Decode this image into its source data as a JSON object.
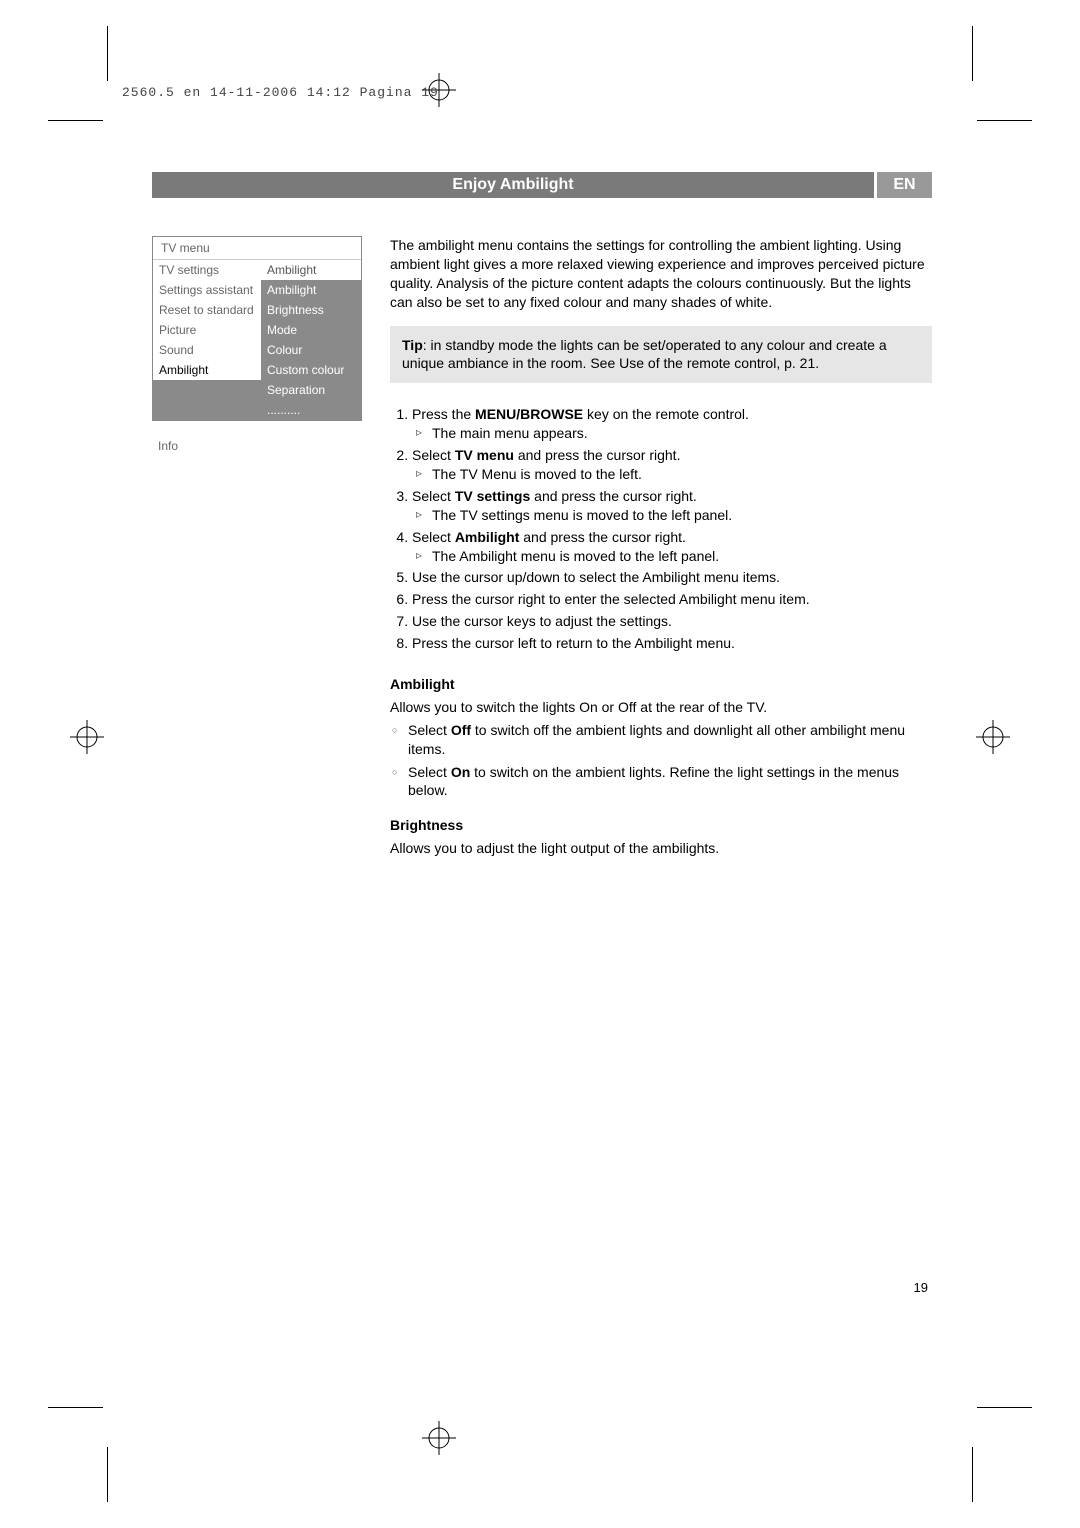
{
  "meta_header": "2560.5 en  14-11-2006  14:12  Pagina 19",
  "title": "Enjoy Ambilight",
  "lang_tag": "EN",
  "menu": {
    "header": "TV menu",
    "left": [
      "TV settings",
      "Settings assistant",
      "Reset to standard",
      "Picture",
      "Sound",
      "Ambilight"
    ],
    "right_header": "Ambilight",
    "right": [
      "Ambilight",
      "Brightness",
      "Mode",
      "Colour",
      "Custom colour",
      "Separation",
      ".........."
    ],
    "info": "Info"
  },
  "intro": "The ambilight menu contains the settings for controlling the ambient lighting. Using ambient light gives a more relaxed viewing experience and improves perceived picture quality. Analysis of the picture content adapts the colours continuously. But the lights can also be set to any fixed colour and many shades of white.",
  "tip_label": "Tip",
  "tip_body": ": in standby mode the lights can be set/operated to any colour and create a unique ambiance in the room. See Use of the remote control, p. 21.",
  "steps": [
    {
      "pre": "Press the ",
      "bold": "MENU/BROWSE",
      "post": " key on the remote control.",
      "sub": "The main menu appears."
    },
    {
      "pre": "Select ",
      "bold": "TV menu",
      "post": " and press the cursor right.",
      "sub": "The TV Menu is moved to the left."
    },
    {
      "pre": "Select ",
      "bold": "TV settings",
      "post": " and press the cursor right.",
      "sub": "The TV settings menu is moved to the left panel."
    },
    {
      "pre": "Select ",
      "bold": "Ambilight",
      "post": " and press the cursor right.",
      "sub": "The Ambilight menu is moved to the left panel."
    },
    {
      "pre": "Use the cursor up/down to select the Ambilight menu items.",
      "bold": "",
      "post": "",
      "sub": ""
    },
    {
      "pre": "Press the cursor right to enter the selected Ambilight menu item.",
      "bold": "",
      "post": "",
      "sub": ""
    },
    {
      "pre": "Use the cursor keys to adjust the settings.",
      "bold": "",
      "post": "",
      "sub": ""
    },
    {
      "pre": "Press the cursor left to return to the Ambilight menu.",
      "bold": "",
      "post": "",
      "sub": ""
    }
  ],
  "sect_ambilight": {
    "title": "Ambilight",
    "intro": "Allows you to switch the lights On or Off at the rear of the TV.",
    "opts": [
      {
        "pre": "Select ",
        "bold": "Off",
        "post": " to switch off the ambient lights and downlight all other ambilight menu items."
      },
      {
        "pre": "Select ",
        "bold": "On",
        "post": " to switch on the ambient lights. Refine the light settings in the menus below."
      }
    ]
  },
  "sect_brightness": {
    "title": "Brightness",
    "intro": "Allows you to adjust the light output of the ambilights."
  },
  "page_number": "19"
}
